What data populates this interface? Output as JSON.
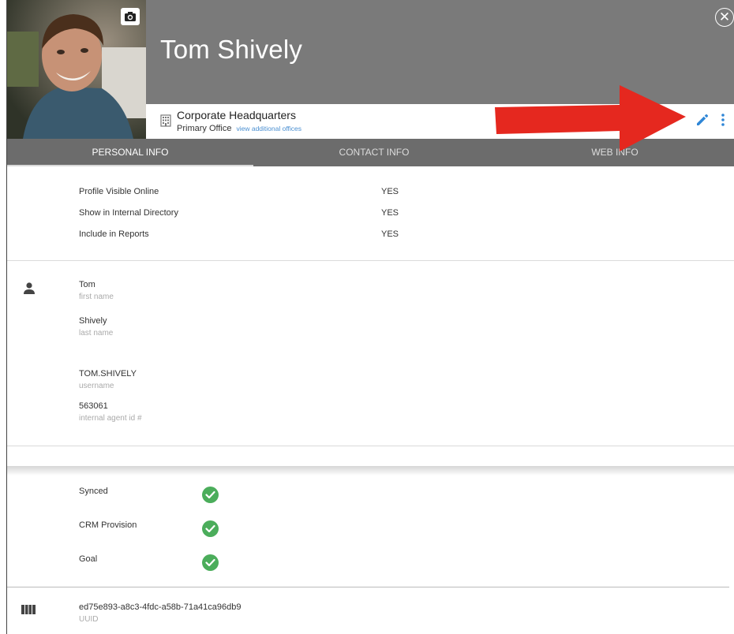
{
  "profile": {
    "name": "Tom Shively",
    "office_name": "Corporate Headquarters",
    "office_role": "Primary Office",
    "office_link": "view additional offices"
  },
  "icons": {
    "camera": "camera-icon",
    "close": "close-icon",
    "building": "building-icon",
    "edit": "pencil-icon",
    "more": "vertical-dots-icon",
    "person": "person-icon",
    "check": "check-circle-icon",
    "uuid": "barcode-icon"
  },
  "tabs": [
    {
      "label": "PERSONAL INFO",
      "active": true
    },
    {
      "label": "CONTACT INFO",
      "active": false
    },
    {
      "label": "WEB INFO",
      "active": false
    }
  ],
  "visibility": [
    {
      "label": "Profile Visible Online",
      "value": "YES"
    },
    {
      "label": "Show in Internal Directory",
      "value": "YES"
    },
    {
      "label": "Include in Reports",
      "value": "YES"
    }
  ],
  "fields": [
    {
      "value": "Tom",
      "label": "first name"
    },
    {
      "value": "Shively",
      "label": "last name"
    },
    {
      "value": "TOM.SHIVELY",
      "label": "username"
    },
    {
      "value": "563061",
      "label": "internal agent id #"
    }
  ],
  "statuses": [
    {
      "label": "Synced"
    },
    {
      "label": "CRM Provision"
    },
    {
      "label": "Goal"
    }
  ],
  "uuid": {
    "value": "ed75e893-a8c3-4fdc-a58b-71a41ca96db9",
    "label": "UUID"
  },
  "colors": {
    "header": "#7a7a7a",
    "tabs": "#6c6c6c",
    "accent_blue": "#2f86d6",
    "check_green": "#4bad5b",
    "arrow_red": "#e5281f"
  }
}
